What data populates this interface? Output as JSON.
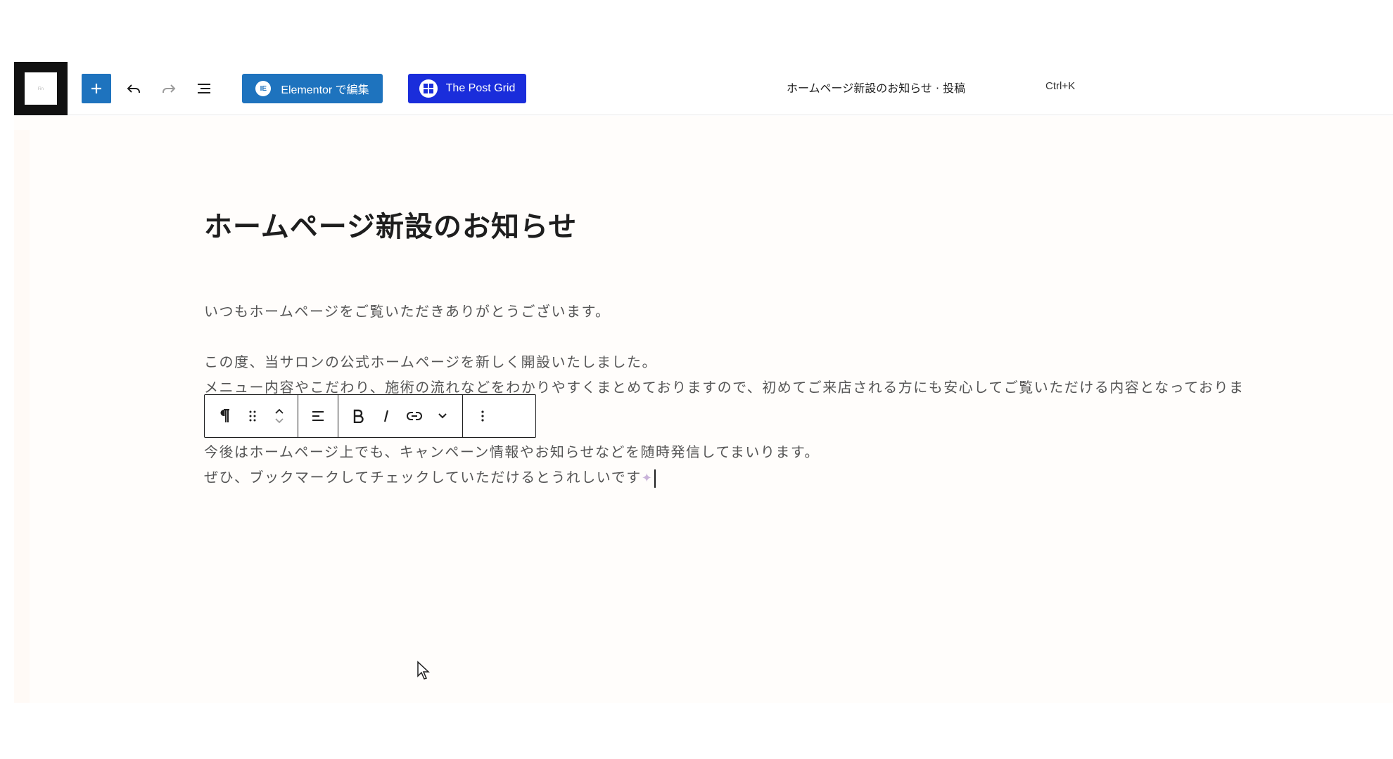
{
  "toolbar": {
    "elementor_label": "Elementor で編集",
    "postgrid_label": "The Post Grid",
    "document_title": "ホームページ新設のお知らせ · 投稿",
    "shortcut": "Ctrl+K",
    "icons": {
      "add": "plus-icon",
      "undo": "undo-icon",
      "redo": "redo-icon",
      "list_view": "list-view-icon"
    },
    "colors": {
      "add_button": "#1e73be",
      "elementor_button": "#1e73be",
      "postgrid_button": "#1a2ddb"
    }
  },
  "post": {
    "title": "ホームページ新設のお知らせ",
    "paragraphs": [
      "いつもホームページをご覧いただきありがとうございます。",
      "この度、当サロンの公式ホームページを新しく開設いたしました。",
      "メニュー内容やこだわり、施術の流れなどをわかりやすくまとめておりますので、初めてご来店される方にも安心してご覧いただける内容となっておりま",
      "今後はホームページ上でも、キャンペーン情報やお知らせなどを随時発信してまいります。",
      "ぜひ、ブックマークしてチェックしていただけるとうれしいです"
    ]
  },
  "block_toolbar": {
    "paragraph_icon": "pilcrow-icon",
    "drag_icon": "drag-handle-icon",
    "move_up_icon": "chevron-up-icon",
    "move_down_icon": "chevron-down-icon",
    "align_icon": "align-left-icon",
    "bold_icon": "bold-icon",
    "italic_icon": "italic-icon",
    "link_icon": "link-icon",
    "more_format_icon": "chevron-down-icon",
    "options_icon": "more-vertical-icon"
  }
}
